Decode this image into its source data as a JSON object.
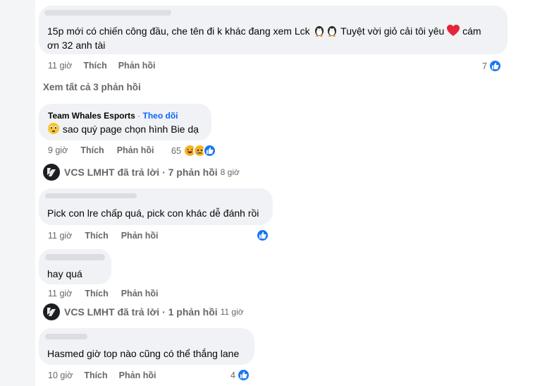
{
  "comment1": {
    "text_line1": "15p mới có chiến công đầu, che tên đi k khác đang xem Lck",
    "text_line1_tail": "Tuyệt vời giỏ cải tôi yêu",
    "text_line1_end": "cám",
    "text_line2": "ơn 32 anh tài",
    "time": "11 giờ",
    "like_label": "Thích",
    "reply_label": "Phản hồi",
    "reaction_count": "7"
  },
  "see_all_replies": "Xem tất cả 3 phản hồi",
  "comment2": {
    "author": "Team Whales Esports",
    "separator": "·",
    "follow_label": "Theo dõi",
    "text": "sao quý page chọn hình Bie dạ",
    "time": "9 giờ",
    "like_label": "Thích",
    "reply_label": "Phản hồi",
    "reaction_count": "65"
  },
  "reply_summary1": {
    "who": "VCS LMHT đã trả lời · 7 phản hồi",
    "when": "8 giờ"
  },
  "comment3": {
    "text": "Pick con lre chấp quá, pick con khác dễ đánh rồi",
    "time": "11 giờ",
    "like_label": "Thích",
    "reply_label": "Phản hồi"
  },
  "comment4": {
    "text": "hay quá",
    "time": "11 giờ",
    "like_label": "Thích",
    "reply_label": "Phản hồi"
  },
  "reply_summary2": {
    "who": "VCS LMHT đã trả lời · 1 phản hồi",
    "when": "11 giờ"
  },
  "comment5": {
    "text": "Hasmed giờ top nào cũng có thể thắng lane",
    "time": "10 giờ",
    "like_label": "Thích",
    "reply_label": "Phản hồi",
    "reaction_count": "4"
  },
  "colors": {
    "bubble": "#f0f2f5",
    "meta": "#65676b",
    "like_blue": "#1877f2",
    "follow_blue": "#0866ff",
    "heart_red": "#e4253a"
  }
}
